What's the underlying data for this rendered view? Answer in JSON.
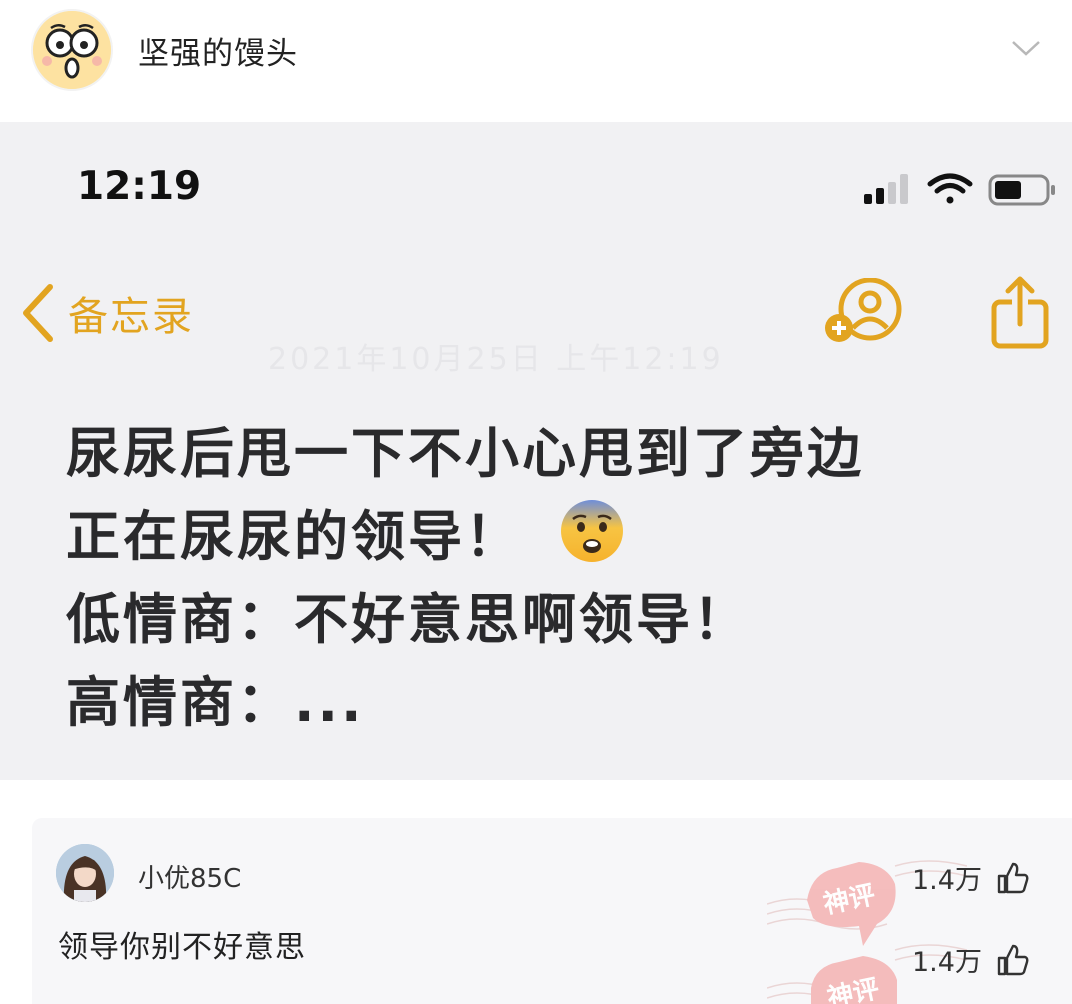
{
  "author": {
    "name": "坚强的馒头"
  },
  "screenshot": {
    "status_time": "12:19",
    "back_label": "备忘录",
    "faded_date": "2021年10月25日 上午12:19",
    "lines": [
      "尿尿后甩一下不小心甩到了旁边",
      "正在尿尿的领导！",
      "低情商：不好意思啊领导！",
      "高情商：..."
    ]
  },
  "comments": [
    {
      "user": "小优85C",
      "likes": "1.4万",
      "text": "领导你别不好意思",
      "reply_likes": "1.4万"
    }
  ],
  "stamp_label": "神评",
  "colors": {
    "accent": "#e2a420",
    "background": "#f1f1f3",
    "stamp": "#f4b6b6"
  }
}
